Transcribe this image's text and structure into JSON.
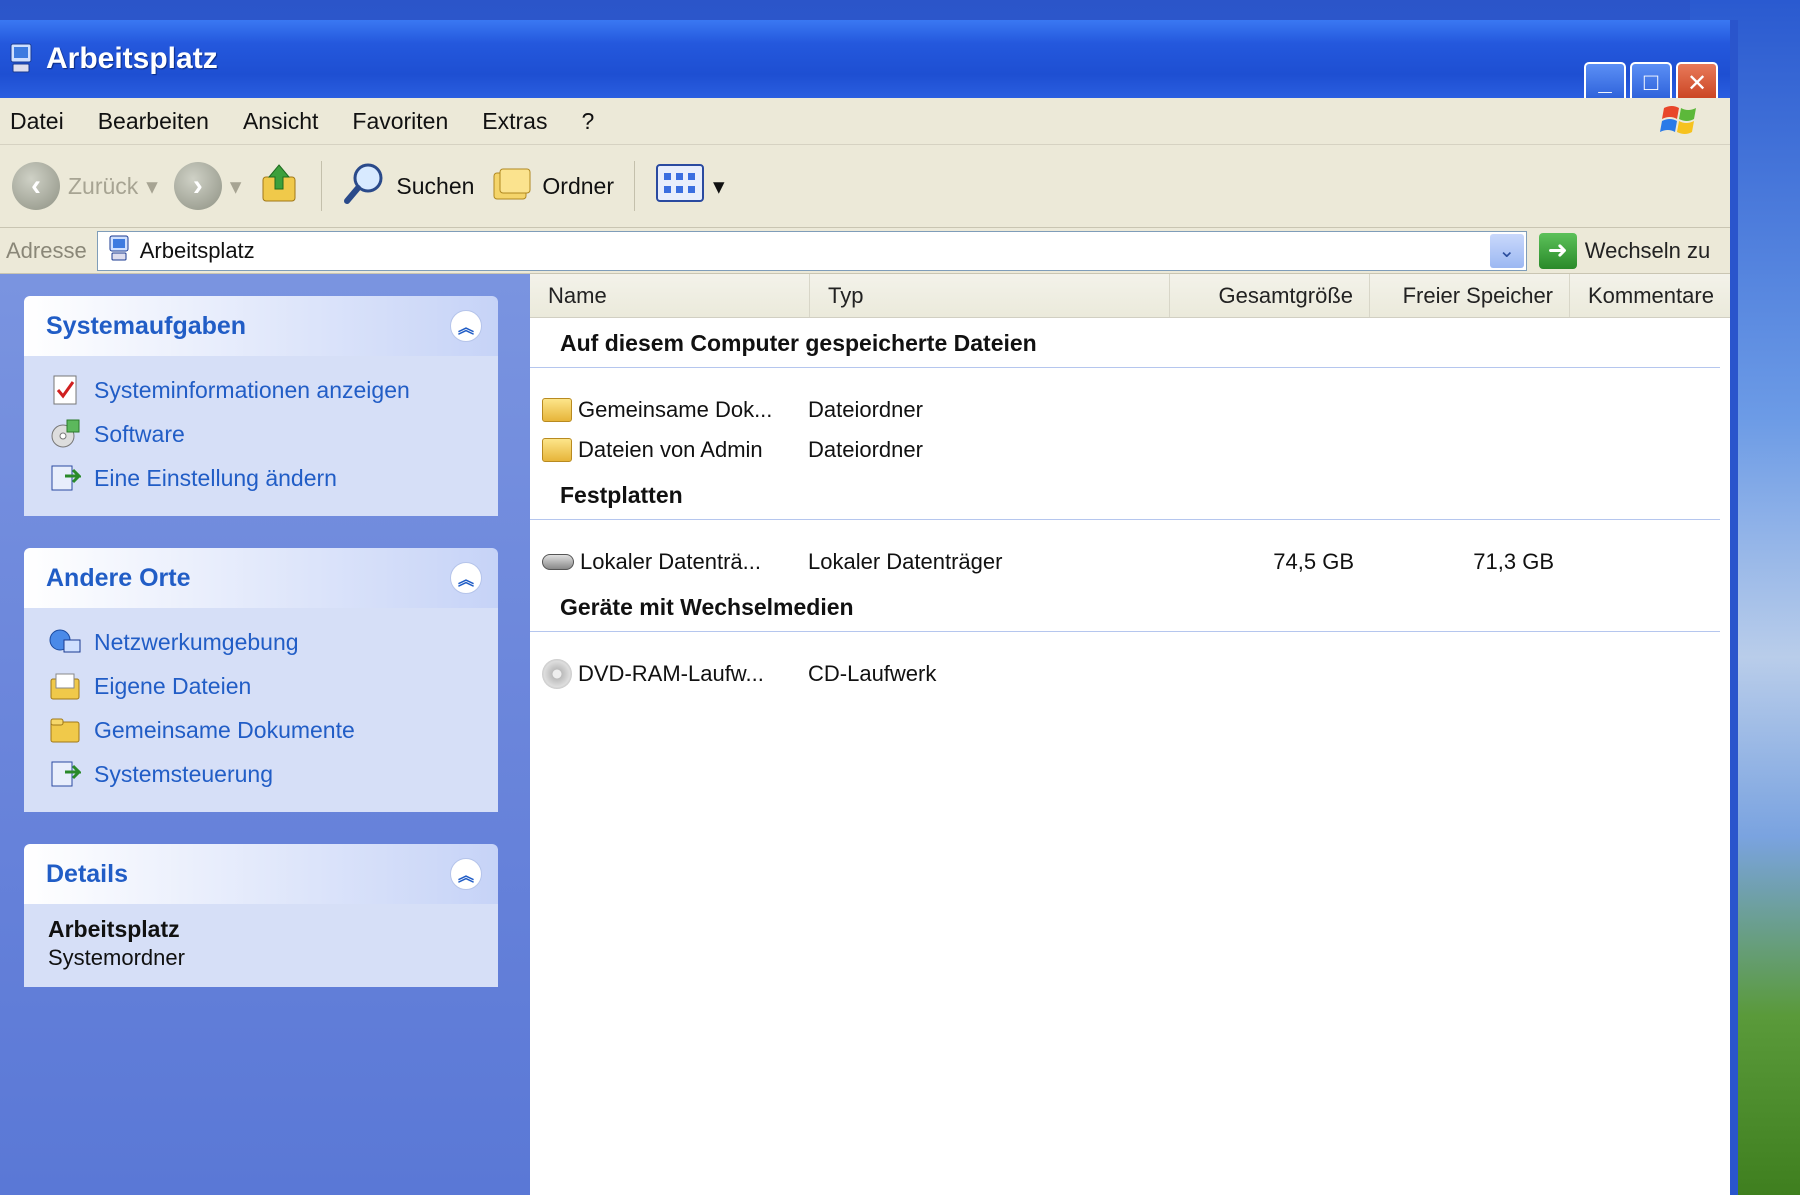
{
  "window": {
    "title": "Arbeitsplatz",
    "buttons": {
      "minimize": "_",
      "maximize": "□",
      "close": "✕"
    }
  },
  "menu": [
    "Datei",
    "Bearbeiten",
    "Ansicht",
    "Favoriten",
    "Extras",
    "?"
  ],
  "toolbar": {
    "back_label": "Zurück",
    "search_label": "Suchen",
    "folders_label": "Ordner"
  },
  "address": {
    "label": "Adresse",
    "value": "Arbeitsplatz",
    "go_label": "Wechseln zu"
  },
  "taskpane": {
    "system_tasks": {
      "title": "Systemaufgaben",
      "items": [
        {
          "label": "Systeminformationen anzeigen",
          "icon": "system-info-icon"
        },
        {
          "label": "Software",
          "icon": "software-icon"
        },
        {
          "label": "Eine Einstellung ändern",
          "icon": "settings-icon"
        }
      ]
    },
    "other_places": {
      "title": "Andere Orte",
      "items": [
        {
          "label": "Netzwerkumgebung",
          "icon": "network-icon"
        },
        {
          "label": "Eigene Dateien",
          "icon": "my-documents-icon"
        },
        {
          "label": "Gemeinsame Dokumente",
          "icon": "shared-folder-icon"
        },
        {
          "label": "Systemsteuerung",
          "icon": "control-panel-icon"
        }
      ]
    },
    "details": {
      "title": "Details",
      "name": "Arbeitsplatz",
      "subtitle": "Systemordner"
    }
  },
  "listview": {
    "columns": [
      "Name",
      "Typ",
      "Gesamtgröße",
      "Freier Speicher",
      "Kommentare"
    ],
    "groups": [
      {
        "title": "Auf diesem Computer gespeicherte Dateien",
        "rows": [
          {
            "name": "Gemeinsame Dok...",
            "type": "Dateiordner",
            "total": "",
            "free": ""
          },
          {
            "name": "Dateien von Admin",
            "type": "Dateiordner",
            "total": "",
            "free": ""
          }
        ]
      },
      {
        "title": "Festplatten",
        "rows": [
          {
            "name": "Lokaler Datenträ...",
            "type": "Lokaler Datenträger",
            "total": "74,5 GB",
            "free": "71,3 GB"
          }
        ]
      },
      {
        "title": "Geräte mit Wechselmedien",
        "rows": [
          {
            "name": "DVD-RAM-Laufw...",
            "type": "CD-Laufwerk",
            "total": "",
            "free": ""
          }
        ]
      }
    ]
  }
}
